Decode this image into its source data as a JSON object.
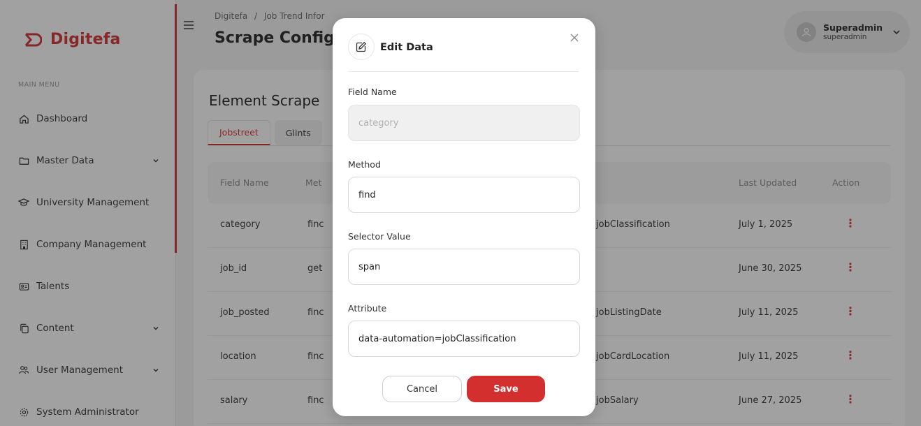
{
  "brand": {
    "name": "Digitefa",
    "color": "#d32f2f"
  },
  "sidebar": {
    "menu_label": "MAIN MENU",
    "items": [
      {
        "label": "Dashboard",
        "icon": "home-icon",
        "has_chevron": false
      },
      {
        "label": "Master Data",
        "icon": "folder-icon",
        "has_chevron": true
      },
      {
        "label": "University Management",
        "icon": "graduation-cap-icon",
        "has_chevron": false
      },
      {
        "label": "Company Management",
        "icon": "building-icon",
        "has_chevron": false
      },
      {
        "label": "Talents",
        "icon": "id-card-icon",
        "has_chevron": false
      },
      {
        "label": "Content",
        "icon": "copy-icon",
        "has_chevron": true
      },
      {
        "label": "User Management",
        "icon": "users-icon",
        "has_chevron": true
      },
      {
        "label": "System Administrator",
        "icon": "gear-icon",
        "has_chevron": false
      }
    ]
  },
  "header": {
    "breadcrumb": [
      "Digitefa",
      "/",
      "Job Trend Infor"
    ],
    "title": "Scrape Config",
    "user": {
      "name": "Superadmin",
      "role": "superadmin"
    }
  },
  "main": {
    "card_title": "Element Scrape",
    "tabs": [
      {
        "label": "Jobstreet",
        "active": true
      },
      {
        "label": "Glints",
        "active": false
      }
    ],
    "table": {
      "headers": {
        "field_name": "Field Name",
        "method": "Met",
        "last_updated": "Last Updated",
        "action": "Action"
      },
      "rows": [
        {
          "field_name": "category",
          "method": "finc",
          "attribute": "jobClassification",
          "last_updated": "July 1, 2025"
        },
        {
          "field_name": "job_id",
          "method": "get",
          "attribute": "",
          "last_updated": "June 30, 2025"
        },
        {
          "field_name": "job_posted",
          "method": "finc",
          "attribute": "jobListingDate",
          "last_updated": "July 11, 2025"
        },
        {
          "field_name": "location",
          "method": "finc",
          "attribute": "jobCardLocation",
          "last_updated": "July 11, 2025"
        },
        {
          "field_name": "salary",
          "method": "finc",
          "attribute": "jobSalary",
          "last_updated": "June 27, 2025"
        }
      ],
      "action_glyph": "⋮"
    }
  },
  "modal": {
    "title": "Edit Data",
    "fields": {
      "field_name": {
        "label": "Field Name",
        "value": "category"
      },
      "method": {
        "label": "Method",
        "value": "find"
      },
      "selector_value": {
        "label": "Selector Value",
        "value": "span"
      },
      "attribute": {
        "label": "Attribute",
        "value": "data-automation=jobClassification"
      }
    },
    "cancel_label": "Cancel",
    "save_label": "Save"
  }
}
